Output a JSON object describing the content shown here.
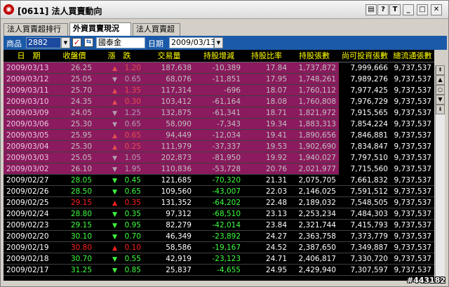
{
  "window": {
    "title": "[0611] 法人買賣動向",
    "btn_help": "?",
    "btn_t": "T"
  },
  "tabs": [
    {
      "label": "法人買賣超排行"
    },
    {
      "label": "外資買賣現況"
    },
    {
      "label": "法人買賣超"
    }
  ],
  "toolbar": {
    "product_label": "商品",
    "product_code": "2882",
    "stock_name": "國泰金",
    "date_label": "日期",
    "date_value": "2009/03/13"
  },
  "columns": [
    "日　期",
    "收盤價",
    "漲　跌",
    "交易量",
    "持股增減",
    "持股比率",
    "持股張數",
    "尚可投資張數",
    "總流通張數"
  ],
  "rows": [
    {
      "date": "2009/03/13",
      "close": "26.25",
      "dir": "up",
      "chg": "1.20",
      "volume": "187,638",
      "net": "-10,389",
      "ratio": "17.84",
      "holdings": "1,737,872",
      "available": "7,999,666",
      "total": "9,737,537",
      "style": "pink"
    },
    {
      "date": "2009/03/12",
      "close": "25.05",
      "dir": "down",
      "chg": "0.65",
      "volume": "68,076",
      "net": "-11,851",
      "ratio": "17.95",
      "holdings": "1,748,261",
      "available": "7,989,276",
      "total": "9,737,537",
      "style": "pink"
    },
    {
      "date": "2009/03/11",
      "close": "25.70",
      "dir": "up",
      "chg": "1.35",
      "volume": "117,314",
      "net": "-696",
      "ratio": "18.07",
      "holdings": "1,760,112",
      "available": "7,977,425",
      "total": "9,737,537",
      "style": "pink"
    },
    {
      "date": "2009/03/10",
      "close": "24.35",
      "dir": "up",
      "chg": "0.30",
      "volume": "103,412",
      "net": "-61,164",
      "ratio": "18.08",
      "holdings": "1,760,808",
      "available": "7,976,729",
      "total": "9,737,537",
      "style": "pink"
    },
    {
      "date": "2009/03/09",
      "close": "24.05",
      "dir": "down",
      "chg": "1.25",
      "volume": "132,875",
      "net": "-61,341",
      "ratio": "18.71",
      "holdings": "1,821,972",
      "available": "7,915,565",
      "total": "9,737,537",
      "style": "pink"
    },
    {
      "date": "2009/03/06",
      "close": "25.30",
      "dir": "down",
      "chg": "0.65",
      "volume": "58,090",
      "net": "-7,343",
      "ratio": "19.34",
      "holdings": "1,883,313",
      "available": "7,854,224",
      "total": "9,737,537",
      "style": "pink"
    },
    {
      "date": "2009/03/05",
      "close": "25.95",
      "dir": "up",
      "chg": "0.65",
      "volume": "94,449",
      "net": "-12,034",
      "ratio": "19.41",
      "holdings": "1,890,656",
      "available": "7,846,881",
      "total": "9,737,537",
      "style": "pink"
    },
    {
      "date": "2009/03/04",
      "close": "25.30",
      "dir": "up",
      "chg": "0.25",
      "volume": "111,979",
      "net": "-37,337",
      "ratio": "19.53",
      "holdings": "1,902,690",
      "available": "7,834,847",
      "total": "9,737,537",
      "style": "pink"
    },
    {
      "date": "2009/03/03",
      "close": "25.05",
      "dir": "down",
      "chg": "1.05",
      "volume": "202,873",
      "net": "-81,950",
      "ratio": "19.92",
      "holdings": "1,940,027",
      "available": "7,797,510",
      "total": "9,737,537",
      "style": "pink"
    },
    {
      "date": "2009/03/02",
      "close": "26.10",
      "dir": "down",
      "chg": "1.95",
      "volume": "110,836",
      "net": "-53,728",
      "ratio": "20.76",
      "holdings": "2,021,977",
      "available": "7,715,560",
      "total": "9,737,537",
      "style": "pink"
    },
    {
      "date": "2009/02/27",
      "close": "28.05",
      "dir": "down",
      "chg": "0.45",
      "volume": "121,685",
      "net": "-70,320",
      "ratio": "21.31",
      "holdings": "2,075,705",
      "available": "7,661,832",
      "total": "9,737,537",
      "style": "dark"
    },
    {
      "date": "2009/02/26",
      "close": "28.50",
      "dir": "down",
      "chg": "0.65",
      "volume": "109,560",
      "net": "-43,007",
      "ratio": "22.03",
      "holdings": "2,146,025",
      "available": "7,591,512",
      "total": "9,737,537",
      "style": "dark"
    },
    {
      "date": "2009/02/25",
      "close": "29.15",
      "dir": "up",
      "chg": "0.35",
      "volume": "131,352",
      "net": "-64,202",
      "ratio": "22.48",
      "holdings": "2,189,032",
      "available": "7,548,505",
      "total": "9,737,537",
      "style": "dark"
    },
    {
      "date": "2009/02/24",
      "close": "28.80",
      "dir": "down",
      "chg": "0.35",
      "volume": "97,312",
      "net": "-68,510",
      "ratio": "23.13",
      "holdings": "2,253,234",
      "available": "7,484,303",
      "total": "9,737,537",
      "style": "dark"
    },
    {
      "date": "2009/02/23",
      "close": "29.15",
      "dir": "down",
      "chg": "0.95",
      "volume": "82,279",
      "net": "-42,014",
      "ratio": "23.84",
      "holdings": "2,321,744",
      "available": "7,415,793",
      "total": "9,737,537",
      "style": "dark"
    },
    {
      "date": "2009/02/20",
      "close": "30.10",
      "dir": "down",
      "chg": "0.70",
      "volume": "46,349",
      "net": "-23,892",
      "ratio": "24.27",
      "holdings": "2,363,758",
      "available": "7,373,779",
      "total": "9,737,537",
      "style": "dark"
    },
    {
      "date": "2009/02/19",
      "close": "30.80",
      "dir": "up",
      "chg": "0.10",
      "volume": "58,586",
      "net": "-19,167",
      "ratio": "24.52",
      "holdings": "2,387,650",
      "available": "7,349,887",
      "total": "9,737,537",
      "style": "dark"
    },
    {
      "date": "2009/02/18",
      "close": "30.70",
      "dir": "down",
      "chg": "0.55",
      "volume": "42,919",
      "net": "-23,123",
      "ratio": "24.71",
      "holdings": "2,406,817",
      "available": "7,330,720",
      "total": "9,737,537",
      "style": "dark"
    },
    {
      "date": "2009/02/17",
      "close": "31.25",
      "dir": "down",
      "chg": "0.85",
      "volume": "25,837",
      "net": "-4,655",
      "ratio": "24.95",
      "holdings": "2,429,940",
      "available": "7,307,597",
      "total": "9,737,537",
      "style": "dark"
    }
  ],
  "arrows": {
    "up": "▲",
    "down": "▼"
  },
  "watermark": "#443182",
  "colors": {
    "header_text": "#ffff00",
    "pink_row": "#8b1a5e",
    "up": "#ff2020",
    "down": "#40ff40",
    "toolbar": "#1b5aa8"
  }
}
